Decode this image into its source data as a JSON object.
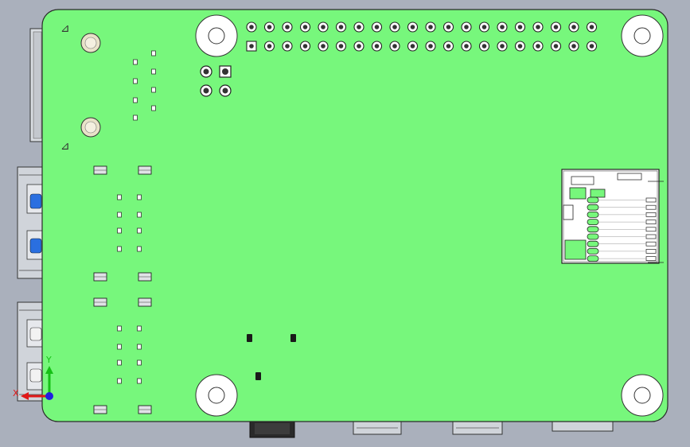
{
  "viewport": {
    "background": "#aab0bc",
    "board_color": "#77f77c",
    "board_outline": "#2b2b2b",
    "component_color": "#c8ccd2",
    "hole_color": "#ffffff"
  },
  "triad": {
    "x_label": "X",
    "y_label": "Y",
    "x_color": "#e01818",
    "y_color": "#16c016",
    "z_color": "#2020e0"
  },
  "silkscreen": {
    "top_glyph": "⊿",
    "bottom_glyph": "⊿"
  }
}
